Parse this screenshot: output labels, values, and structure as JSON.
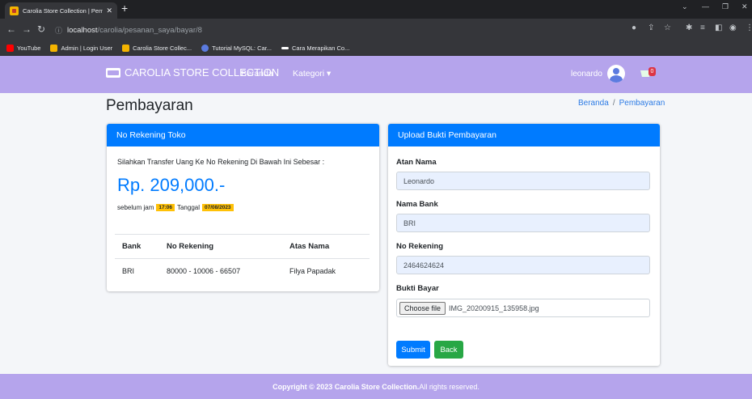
{
  "browser": {
    "tab_title": "Carolia Store Collection | Pembay",
    "url_host": "localhost",
    "url_path": "/carolia/pesanan_saya/bayar/8",
    "bookmarks": [
      {
        "label": "YouTube",
        "color": "#ff0000"
      },
      {
        "label": "Admin | Login User",
        "color": "#f4b400"
      },
      {
        "label": "Carolia Store Collec...",
        "color": "#f4b400"
      },
      {
        "label": "Tutorial MySQL: Car...",
        "color": "#5b7be0"
      },
      {
        "label": "Cara Merapikan Co...",
        "color": "#ffffff"
      }
    ]
  },
  "navbar": {
    "brand": "CAROLIA STORE COLLECTION",
    "links": [
      "Beranda",
      "Kategori ▾"
    ],
    "username": "leonardo",
    "cart_count": "0",
    "color": "#b5a4ec"
  },
  "page": {
    "title": "Pembayaran",
    "breadcrumb": [
      "Beranda",
      "/",
      "Pembayaran"
    ]
  },
  "rekening_card": {
    "header": "No Rekening Toko",
    "instruction": "Silahkan Transfer Uang Ke No Rekening Di Bawah Ini Sebesar :",
    "amount": "Rp. 209,000.-",
    "deadline_prefix": "sebelum jam",
    "deadline_time": "17:06",
    "deadline_mid": "Tanggal",
    "deadline_date": "07/08/2023",
    "table": {
      "headers": [
        "Bank",
        "No Rekening",
        "Atas Nama"
      ],
      "rows": [
        [
          "BRI",
          "80000 - 10006 - 66507",
          "Filya Papadak"
        ]
      ]
    }
  },
  "upload_card": {
    "header": "Upload Bukti Pembayaran",
    "fields": [
      {
        "label": "Atan Nama",
        "value": "Leonardo"
      },
      {
        "label": "Nama Bank",
        "value": "BRI"
      },
      {
        "label": "No Rekening",
        "value": "2464624624"
      }
    ],
    "file_label": "Bukti Bayar",
    "file_button": "Choose file",
    "file_name": "IMG_20200915_135958.jpg",
    "submit_label": "Submit",
    "back_label": "Back"
  },
  "footer": {
    "bold": "Copyright © 2023 Carolia Store Collection.",
    "rest": " All rights reserved."
  },
  "colors": {
    "primary": "#007bff",
    "success": "#28a745",
    "warning": "#ffc107",
    "navbar": "#b5a4ec"
  }
}
